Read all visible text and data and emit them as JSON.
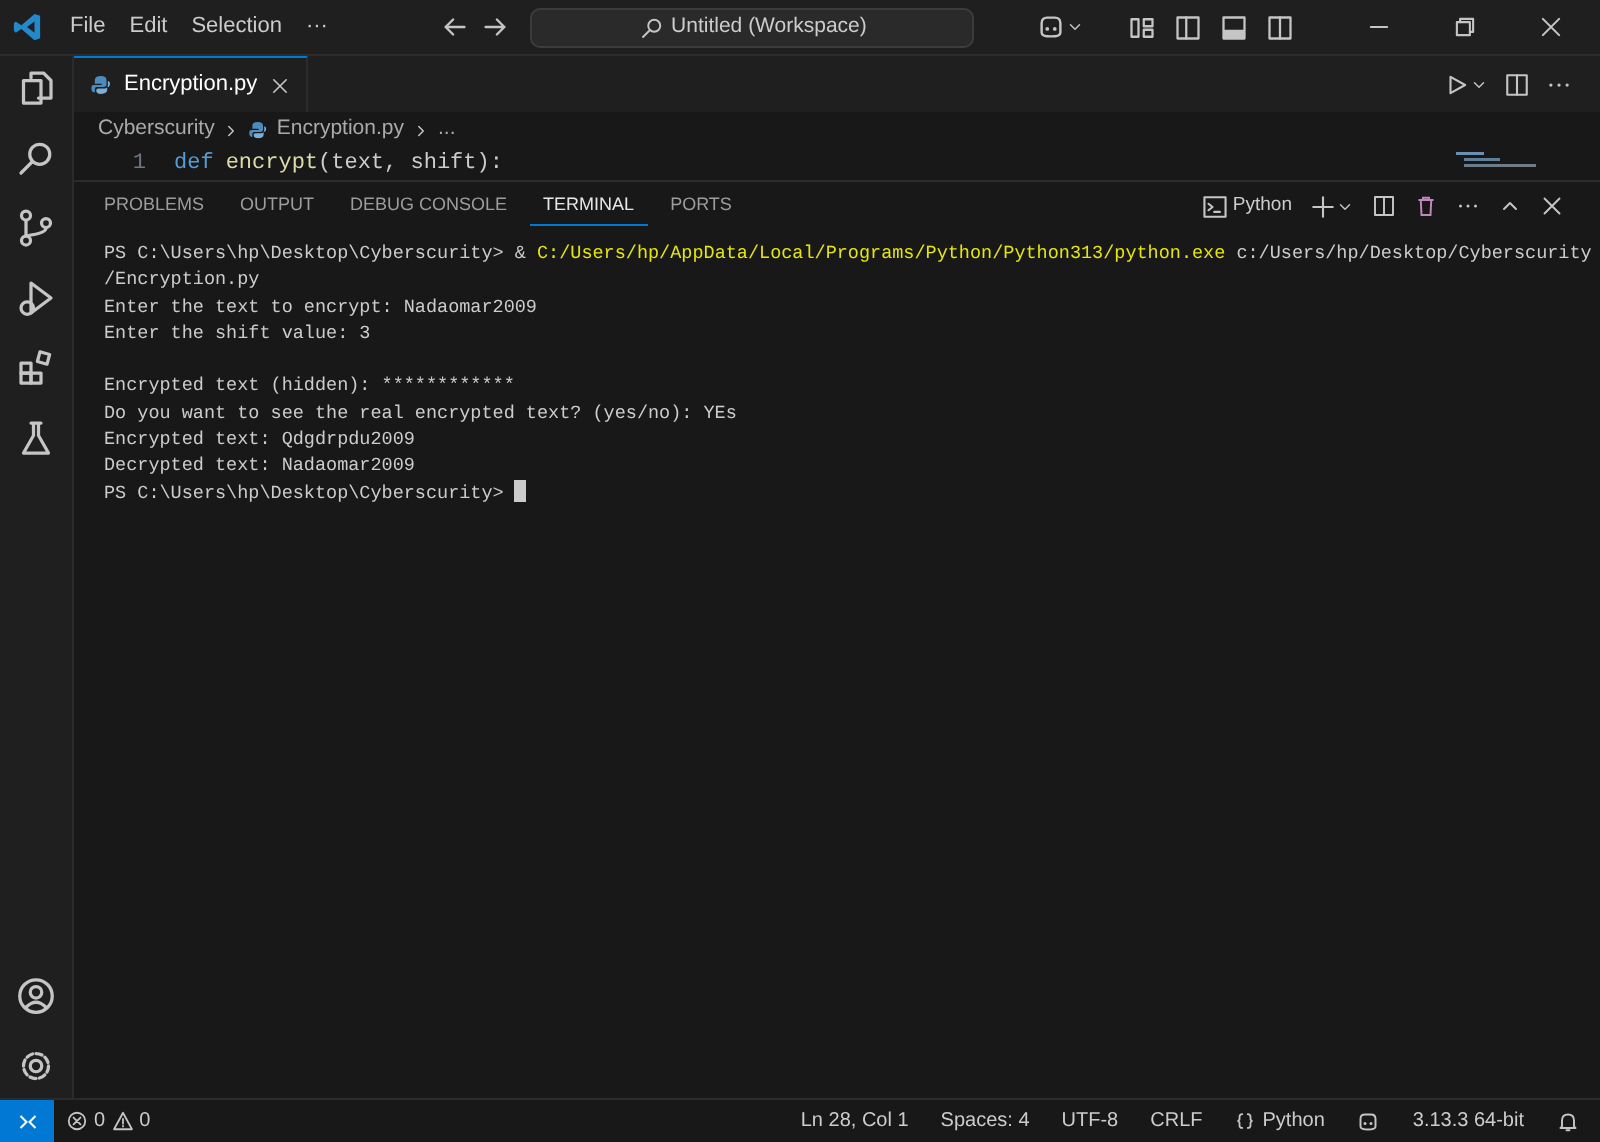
{
  "title_bar": {
    "menus": [
      "File",
      "Edit",
      "Selection",
      "···"
    ],
    "command_center": "Untitled (Workspace)"
  },
  "editor": {
    "tabs": [
      {
        "label": "Encryption.py",
        "selected": true
      }
    ],
    "breadcrumb": [
      "Cyberscurity",
      "Encryption.py",
      "..."
    ],
    "code_lines": [
      {
        "number": "1",
        "segments": [
          {
            "kind": "keyword",
            "text": "def"
          },
          {
            "kind": "function",
            "text": "encrypt"
          },
          {
            "kind": "plain",
            "text": "(text, shift):"
          }
        ]
      }
    ]
  },
  "panel": {
    "tabs": [
      {
        "label": "PROBLEMS",
        "selected": false
      },
      {
        "label": "OUTPUT",
        "selected": false
      },
      {
        "label": "DEBUG CONSOLE",
        "selected": false
      },
      {
        "label": "TERMINAL",
        "selected": true
      },
      {
        "label": "PORTS",
        "selected": false
      }
    ],
    "terminal_name": "Python",
    "blocks": [
      {
        "lines": [
          {
            "segments": [
              {
                "kind": "plain",
                "text": "PS C:\\Users\\hp\\Desktop\\Cyberscurity> & "
              },
              {
                "kind": "command",
                "text": "C:/Users/hp/AppData/Local/Programs/Python/Python313/python.exe"
              },
              {
                "kind": "plain",
                "text": " c:/Users/hp/Desktop/Cyberscurity"
              }
            ]
          },
          {
            "segments": [
              {
                "kind": "plain",
                "text": "/Encryption.py"
              }
            ]
          },
          {
            "segments": [
              {
                "kind": "plain",
                "text": "Enter the text to encrypt: Nadaomar2009"
              }
            ]
          },
          {
            "segments": [
              {
                "kind": "plain",
                "text": "Enter the shift value: 3"
              }
            ]
          }
        ]
      },
      {
        "lines": [
          {
            "segments": [
              {
                "kind": "plain",
                "text": "Encrypted text (hidden): ************"
              }
            ]
          },
          {
            "segments": [
              {
                "kind": "plain",
                "text": "Do you want to see the real encrypted text? (yes/no): YEs"
              }
            ]
          },
          {
            "segments": [
              {
                "kind": "plain",
                "text": "Encrypted text: Qdgdrpdu2009"
              }
            ]
          },
          {
            "segments": [
              {
                "kind": "plain",
                "text": "Decrypted text: Nadaomar2009"
              }
            ]
          },
          {
            "segments": [
              {
                "kind": "plain",
                "text": "PS C:\\Users\\hp\\Desktop\\Cyberscurity> "
              },
              {
                "kind": "cursor"
              }
            ]
          }
        ]
      }
    ]
  },
  "status_bar": {
    "errors": "0",
    "warnings": "0",
    "items": [
      {
        "kind": "text",
        "text": "Ln 28, Col 1"
      },
      {
        "kind": "text",
        "text": "Spaces: 4"
      },
      {
        "kind": "text",
        "text": "UTF-8"
      },
      {
        "kind": "text",
        "text": "CRLF"
      },
      {
        "kind": "language",
        "text": "Python"
      },
      {
        "kind": "copilot"
      },
      {
        "kind": "text",
        "text": "3.13.3 64-bit"
      },
      {
        "kind": "bell"
      }
    ]
  }
}
